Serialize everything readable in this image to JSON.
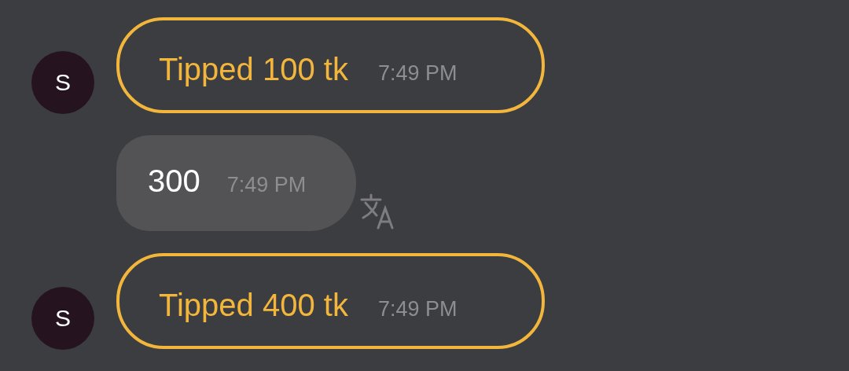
{
  "messages": [
    {
      "kind": "tip",
      "avatar": "S",
      "text": "Tipped 100 tk",
      "time": "7:49 PM"
    },
    {
      "kind": "text",
      "text": "300",
      "time": "7:49 PM",
      "translatable": true
    },
    {
      "kind": "tip",
      "avatar": "S",
      "text": "Tipped 400 tk",
      "time": "7:49 PM"
    }
  ]
}
